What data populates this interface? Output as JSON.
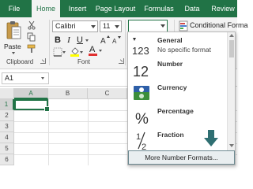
{
  "tabs": [
    {
      "label": "File",
      "active": false
    },
    {
      "label": "Home",
      "active": true
    },
    {
      "label": "Insert",
      "active": false
    },
    {
      "label": "Page Layout",
      "active": false
    },
    {
      "label": "Formulas",
      "active": false
    },
    {
      "label": "Data",
      "active": false
    },
    {
      "label": "Review",
      "active": false
    }
  ],
  "ribbon": {
    "clipboard": {
      "paste_label": "Paste",
      "group_label": "Clipboard"
    },
    "font": {
      "font_name": "Calibri",
      "font_size": "11",
      "group_label": "Font",
      "bold": "B",
      "italic": "I",
      "underline": "U",
      "font_color_letter": "A"
    },
    "number": {
      "format_value": ""
    },
    "styles": {
      "conditional_format_label": "Conditional Forma"
    }
  },
  "formula_bar": {
    "name_box": "A1"
  },
  "grid": {
    "columns": [
      "A",
      "B",
      "C"
    ],
    "rows": [
      "1",
      "2",
      "3",
      "4",
      "5",
      "6"
    ],
    "selected_cell": "A1"
  },
  "number_format_dropdown": {
    "items": [
      {
        "title": "General",
        "subtitle": "No specific format",
        "icon": "general-123-icon"
      },
      {
        "title": "Number",
        "subtitle": "",
        "icon": "number-12-icon"
      },
      {
        "title": "Currency",
        "subtitle": "",
        "icon": "currency-icon"
      },
      {
        "title": "Percentage",
        "subtitle": "",
        "icon": "percent-icon"
      },
      {
        "title": "Fraction",
        "subtitle": "",
        "icon": "fraction-icon"
      }
    ],
    "more_label": "More Number Formats..."
  },
  "colors": {
    "accent": "#217346",
    "ribbon_bg": "#f3f3f3",
    "currency_blue": "#2e5fa8",
    "currency_green": "#3b8d3b",
    "arrow_teal": "#2f6f72"
  }
}
